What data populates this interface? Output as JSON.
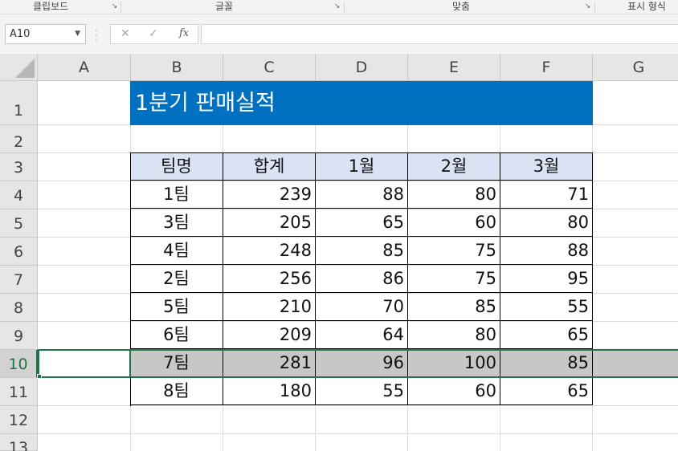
{
  "ribbon": {
    "groups": [
      "클립보드",
      "글꼴",
      "맞춤",
      "표시 형식"
    ]
  },
  "formula_bar": {
    "name_box": "A10",
    "formula": ""
  },
  "columns": [
    "A",
    "B",
    "C",
    "D",
    "E",
    "F",
    "G"
  ],
  "rows": [
    "1",
    "2",
    "3",
    "4",
    "5",
    "6",
    "7",
    "8",
    "9",
    "10",
    "11",
    "12",
    "13"
  ],
  "selected_row": "10",
  "sheet": {
    "title": "1분기 판매실적",
    "headers": [
      "팀명",
      "합계",
      "1월",
      "2월",
      "3월"
    ],
    "data": [
      [
        "1팀",
        "239",
        "88",
        "80",
        "71"
      ],
      [
        "3팀",
        "205",
        "65",
        "60",
        "80"
      ],
      [
        "4팀",
        "248",
        "85",
        "75",
        "88"
      ],
      [
        "2팀",
        "256",
        "86",
        "75",
        "95"
      ],
      [
        "5팀",
        "210",
        "70",
        "85",
        "55"
      ],
      [
        "6팀",
        "209",
        "64",
        "80",
        "65"
      ],
      [
        "7팀",
        "281",
        "96",
        "100",
        "85"
      ],
      [
        "8팀",
        "180",
        "55",
        "60",
        "65"
      ]
    ]
  },
  "colors": {
    "accent": "#217346",
    "title_fill": "#0070c0",
    "header_fill": "#dae3f3",
    "selected_fill": "#c7c7c7"
  }
}
